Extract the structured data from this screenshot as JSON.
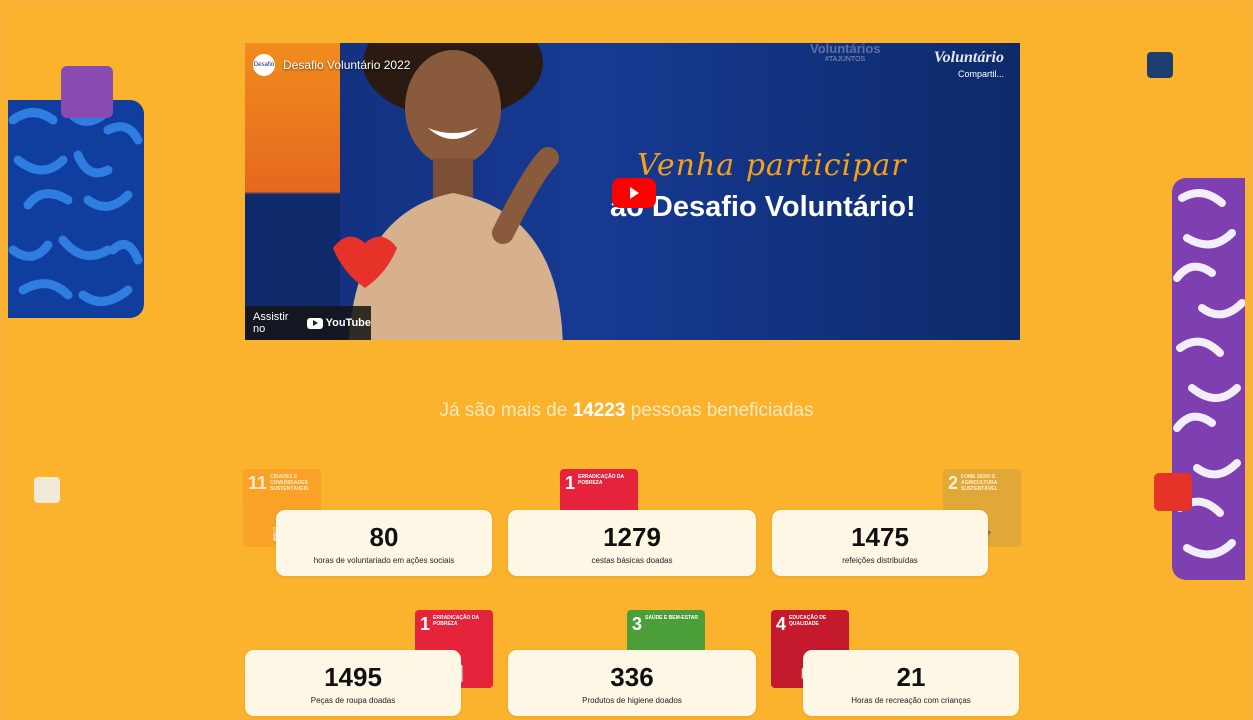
{
  "video": {
    "title": "Desafio Voluntário 2022",
    "channel_avatar_text": "Desafio",
    "brand_logo": "Voluntário",
    "share_label": "Compartil...",
    "top_tag": "Voluntários",
    "top_tag_small": "#TAJUNTOS",
    "headline_script": "Venha participar",
    "headline_bold": "ao Desafio Voluntário!",
    "watch_on_label": "Assistir no",
    "youtube_label": "YouTube"
  },
  "beneficiaries": {
    "prefix": "Já são mais de",
    "count": "14223",
    "suffix": "pessoas beneficiadas"
  },
  "sdg_badges": [
    {
      "number": "11",
      "text": "Cidades e comunidades sustentáveis",
      "color": "#f99d26",
      "glyph": "🏙"
    },
    {
      "number": "1",
      "text": "Erradicação da pobreza",
      "color": "#e5243b",
      "glyph": "👪"
    },
    {
      "number": "2",
      "text": "Fome zero e agricultura sustentável",
      "color": "#dda63a",
      "glyph": "🍲"
    },
    {
      "number": "1",
      "text": "Erradicação da pobreza",
      "color": "#e5243b",
      "glyph": "👪"
    },
    {
      "number": "3",
      "text": "Saúde e bem-estar",
      "color": "#4c9f38",
      "glyph": "♥"
    },
    {
      "number": "4",
      "text": "Educação de qualidade",
      "color": "#c5192d",
      "glyph": "📖"
    }
  ],
  "stats": [
    {
      "value": "80",
      "label": "horas de voluntariado em ações sociais"
    },
    {
      "value": "1279",
      "label": "cestas básicas doadas"
    },
    {
      "value": "1475",
      "label": "refeições distribuídas"
    },
    {
      "value": "1495",
      "label": "Peças de roupa doadas"
    },
    {
      "value": "336",
      "label": "Produtos de higiene doados"
    },
    {
      "value": "21",
      "label": "Horas de recreação com crianças"
    }
  ]
}
